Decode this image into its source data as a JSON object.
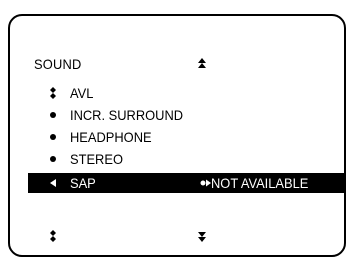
{
  "menu": {
    "title": "SOUND",
    "items": [
      {
        "label": "AVL",
        "marker": "scroll-dots-icon"
      },
      {
        "label": "INCR. SURROUND",
        "marker": "bullet-icon"
      },
      {
        "label": "HEADPHONE",
        "marker": "bullet-icon"
      },
      {
        "label": "STEREO",
        "marker": "bullet-icon"
      },
      {
        "label": "SAP",
        "marker": "left-arrow-icon",
        "selected": true,
        "value": "NOT AVAILABLE",
        "value_marker": "bullet-right-arrow-icon"
      }
    ],
    "indicators": {
      "up": "up-arrow-icon",
      "down": "down-arrow-icon",
      "more": "scroll-dots-icon"
    }
  },
  "colors": {
    "background": "#ffffff",
    "foreground": "#000000",
    "highlight_background": "#000000",
    "highlight_text": "#ffffff"
  }
}
